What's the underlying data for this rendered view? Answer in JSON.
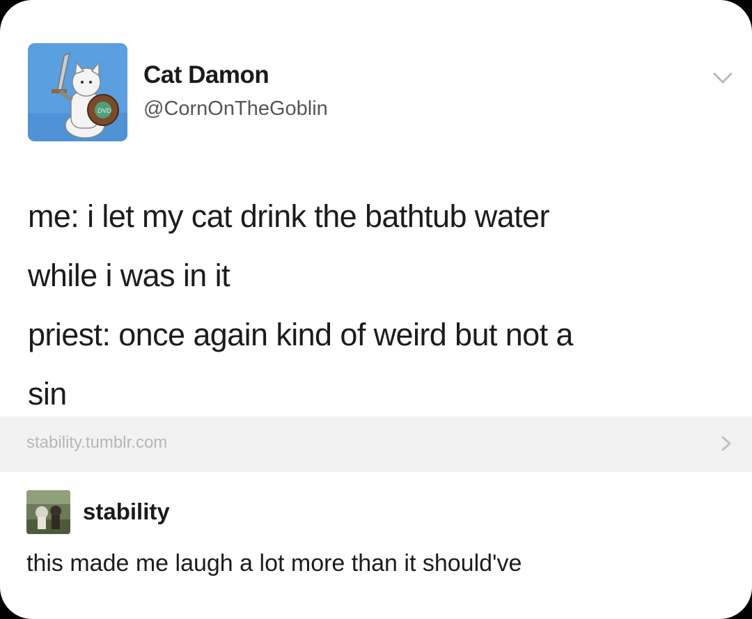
{
  "post": {
    "author": {
      "display_name": "Cat Damon",
      "handle": "@CornOnTheGoblin",
      "avatar_icon": "cat-knight-avatar"
    },
    "menu_icon": "chevron-down-icon",
    "text_lines": [
      "me: i let my cat drink the bathtub water",
      "while i was in it",
      "priest: once again kind of weird but not a",
      "sin"
    ]
  },
  "source": {
    "label": "stability.tumblr.com",
    "icon": "chevron-right-icon"
  },
  "reblog": {
    "username": "stability",
    "avatar_icon": "user-avatar-photo",
    "comment": "this made me laugh a lot more than it should've"
  },
  "colors": {
    "background": "#000000",
    "card": "#ffffff",
    "source_bar": "#f2f2f2",
    "avatar_blue": "#5a9fe0"
  }
}
